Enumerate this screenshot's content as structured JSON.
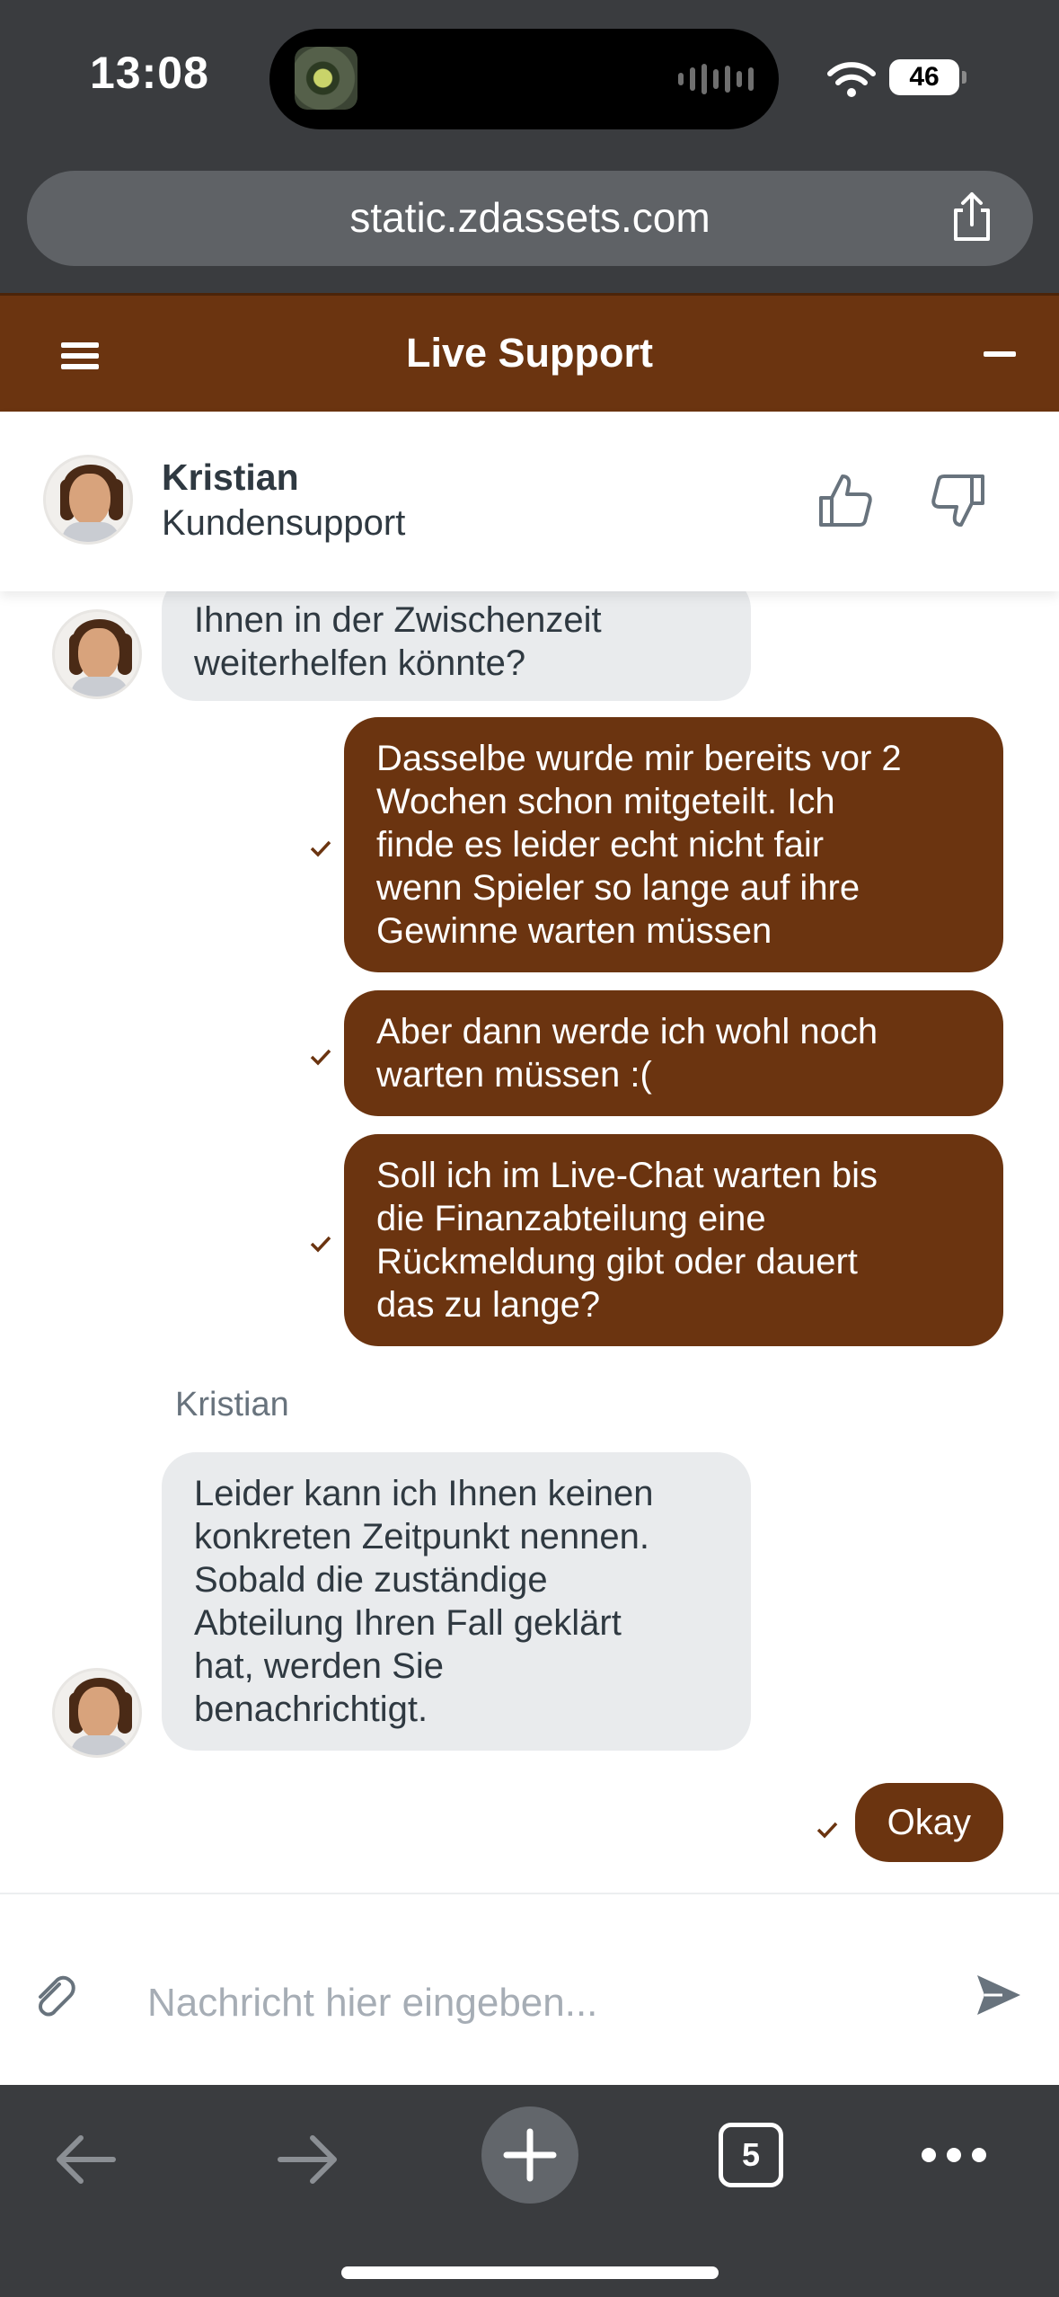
{
  "status_bar": {
    "time": "13:08",
    "battery": "46"
  },
  "browser": {
    "url": "static.zdassets.com",
    "open_tabs_count": "5"
  },
  "header": {
    "title": "Live Support"
  },
  "agent": {
    "name": "Kristian",
    "role": "Kundensupport"
  },
  "messages": {
    "m1": {
      "line1": "Ihnen in der Zwischenzeit",
      "line2": "weiterhelfen könnte?"
    },
    "m2": {
      "line1": "Dasselbe wurde mir bereits vor 2",
      "line2": "Wochen schon mitgeteilt. Ich",
      "line3": "finde es leider echt nicht fair",
      "line4": "wenn Spieler so lange auf ihre",
      "line5": "Gewinne warten müssen"
    },
    "m3": {
      "line1": "Aber dann werde ich wohl noch",
      "line2": "warten müssen :("
    },
    "m4": {
      "line1": "Soll ich im Live-Chat warten bis",
      "line2": "die Finanzabteilung eine",
      "line3": "Rückmeldung gibt oder dauert",
      "line4": "das zu lange?"
    },
    "sender": "Kristian",
    "m5": {
      "line1": "Leider kann ich Ihnen keinen",
      "line2": "konkreten Zeitpunkt nennen.",
      "line3": "Sobald die zuständige",
      "line4": "Abteilung Ihren Fall geklärt",
      "line5": "hat, werden Sie",
      "line6": "benachrichtigt."
    },
    "m6": {
      "text": "Okay"
    }
  },
  "composer": {
    "placeholder": "Nachricht hier eingeben..."
  },
  "colors": {
    "brand": "#6b3410",
    "incoming_bubble": "#e9ebed",
    "browser_chrome": "#3a3c3f"
  },
  "icons": [
    "wifi-icon",
    "share-icon",
    "menu-icon",
    "minimize-icon",
    "thumbs-up-icon",
    "thumbs-down-icon",
    "check-icon",
    "paperclip-icon",
    "send-icon",
    "back-arrow-icon",
    "forward-arrow-icon",
    "plus-icon",
    "more-icon"
  ]
}
